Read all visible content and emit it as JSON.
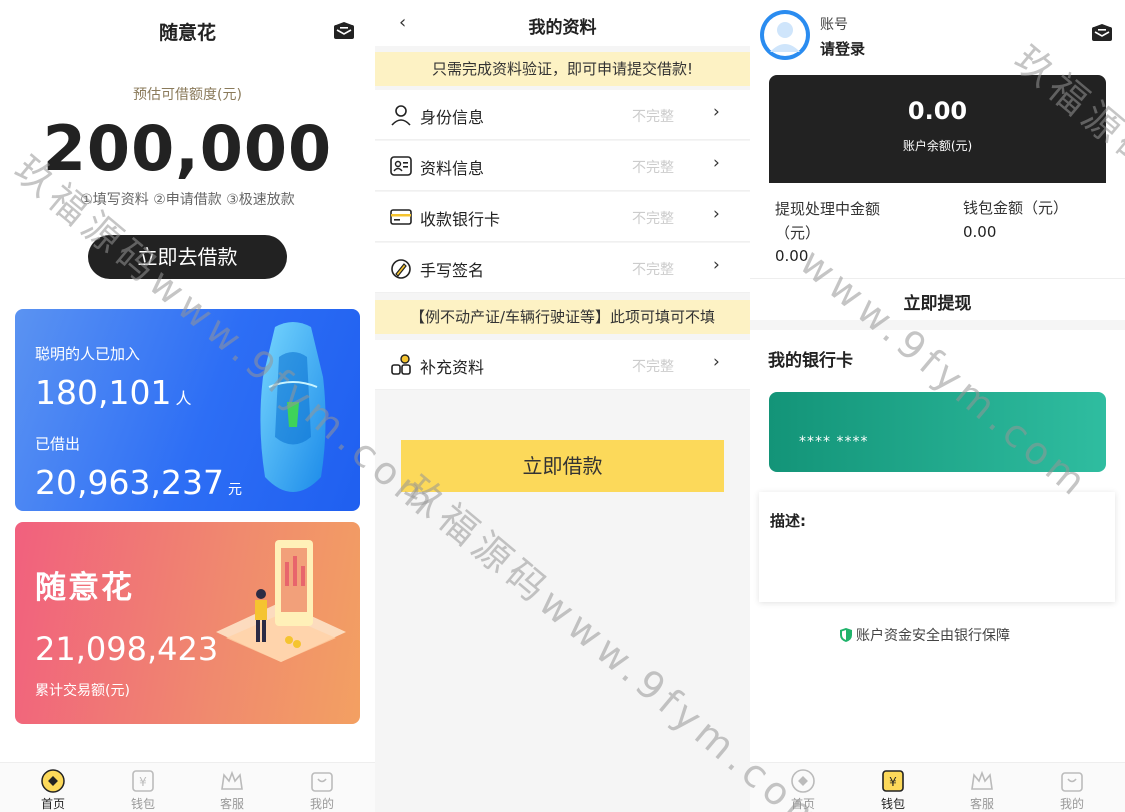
{
  "home": {
    "title": "随意花",
    "subtitle": "预估可借额度(元)",
    "amount": "200,000",
    "steps": "①填写资料 ②申请借款 ③极速放款",
    "cta": "立即去借款",
    "stats_card": {
      "joined_label": "聪明的人已加入",
      "joined_value": "180,101",
      "joined_unit": "人",
      "borrowed_label": "已借出",
      "borrowed_value": "20,963,237",
      "borrowed_unit": "元"
    },
    "brand_card": {
      "brand": "随意花",
      "value": "21,098,423",
      "label": "累计交易额(元)"
    },
    "tabbar": [
      {
        "label": "首页",
        "icon": "home-icon",
        "active": true
      },
      {
        "label": "钱包",
        "icon": "wallet-icon",
        "active": false
      },
      {
        "label": "客服",
        "icon": "service-icon",
        "active": false
      },
      {
        "label": "我的",
        "icon": "profile-icon",
        "active": false
      }
    ]
  },
  "profile_data": {
    "back": "‹",
    "title": "我的资料",
    "notice": "只需完成资料验证，即可申请提交借款!",
    "items": [
      {
        "label": "身份信息",
        "status": "不完整",
        "icon": "person-icon"
      },
      {
        "label": "资料信息",
        "status": "不完整",
        "icon": "id-card-icon"
      },
      {
        "label": "收款银行卡",
        "status": "不完整",
        "icon": "bank-card-icon"
      },
      {
        "label": "手写签名",
        "status": "不完整",
        "icon": "signature-icon"
      }
    ],
    "optional_notice": "【例不动产证/车辆行驶证等】此项可填可不填",
    "extra_item": {
      "label": "补充资料",
      "status": "不完整",
      "icon": "grid-icon"
    },
    "chevron": "›",
    "cta": "立即借款"
  },
  "wallet": {
    "account_label": "账号",
    "login": "请登录",
    "balance_value": "0.00",
    "balance_label": "账户余额(元)",
    "pending_label": "提现处理中金额（元）",
    "pending_value": "0.00",
    "wallet_label": "钱包金额（元）",
    "wallet_value": "0.00",
    "withdraw": "立即提现",
    "bank_title": "我的银行卡",
    "card_number": "**** ****",
    "desc_label": "描述:",
    "secure": "账户资金安全由银行保障",
    "tabbar": [
      {
        "label": "首页",
        "icon": "home-icon",
        "active": false
      },
      {
        "label": "钱包",
        "icon": "wallet-icon",
        "active": true
      },
      {
        "label": "客服",
        "icon": "service-icon",
        "active": false
      },
      {
        "label": "我的",
        "icon": "profile-icon",
        "active": false
      }
    ]
  },
  "watermark": [
    "玖福源码www.9fym.com",
    "www.9fym.com",
    "玖福源码",
    "玖福源码www.9fym.com"
  ],
  "colors": {
    "dark": "#222222",
    "accent_yellow": "#fcd95a",
    "notice_bg": "#fdf2c4",
    "blue_card": "#2d6ef5",
    "pink_card": "#f1607e",
    "green_card": "#139478"
  }
}
